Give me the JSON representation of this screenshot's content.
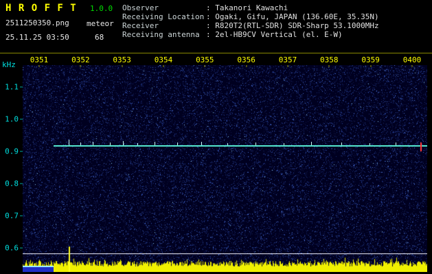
{
  "header": {
    "app_name": "H R O F F T",
    "version": "1.0.0",
    "filename": "2511250350.png",
    "mode": "meteor",
    "datetime": "25.11.25 03:50",
    "echo_count": "68",
    "info": [
      {
        "label": "Observer",
        "value": ": Takanori Kawachi"
      },
      {
        "label": "Receiving Location",
        "value": ": Ogaki, Gifu, JAPAN (136.60E, 35.35N)"
      },
      {
        "label": "Receiver",
        "value": ": R820T2(RTL-SDR) SDR-Sharp 53.1000MHz"
      },
      {
        "label": "Receiving antenna",
        "value": ": 2el-HB9CV Vertical (el. E-W)"
      }
    ]
  },
  "chart_data": {
    "type": "heatmap",
    "title": "",
    "x_axis": {
      "label": "",
      "ticks": [
        "0351",
        "0352",
        "0353",
        "0354",
        "0355",
        "0356",
        "0357",
        "0358",
        "0359",
        "0400"
      ]
    },
    "y_axis": {
      "label": "kHz",
      "ticks": [
        "1.1",
        "1.0",
        "0.9",
        "0.8",
        "0.7",
        "0.6"
      ],
      "range_khz": [
        0.55,
        1.17
      ]
    },
    "carrier_line_khz": 0.92,
    "echoes": [
      {
        "frac": 0.04,
        "height": 8
      },
      {
        "frac": 0.072,
        "height": 4
      },
      {
        "frac": 0.105,
        "height": 5
      },
      {
        "frac": 0.15,
        "height": 4
      },
      {
        "frac": 0.185,
        "height": 6
      },
      {
        "frac": 0.225,
        "height": 3
      },
      {
        "frac": 0.27,
        "height": 5
      },
      {
        "frac": 0.33,
        "height": 4
      },
      {
        "frac": 0.395,
        "height": 5
      },
      {
        "frac": 0.465,
        "height": 3
      },
      {
        "frac": 0.54,
        "height": 4
      },
      {
        "frac": 0.615,
        "height": 3
      },
      {
        "frac": 0.69,
        "height": 5
      },
      {
        "frac": 0.77,
        "height": 4
      },
      {
        "frac": 0.845,
        "height": 3
      },
      {
        "frac": 0.915,
        "height": 4
      },
      {
        "frac": 0.982,
        "height": 13,
        "color": "red"
      }
    ],
    "strong_echo_frac": 0.114,
    "layout_hints": {
      "noise_texture": "dark blue random speckle spectrogram background",
      "level_bars": "yellow amplitude bars along bottom edge",
      "reference_line": "white horizontal line above level bars",
      "cal_bar": "cyan over blue block at bottom-left of plot"
    },
    "colors": {
      "title": "#ffff00",
      "version": "#00dd00",
      "time_labels": "#ffff00",
      "freq_labels": "#00dede",
      "carrier_line": "#55e8cf",
      "level_bars": "#f0f000",
      "reference_line": "#e8e8f2",
      "red_marker": "#ff3333",
      "noise_background": "#000020"
    }
  }
}
